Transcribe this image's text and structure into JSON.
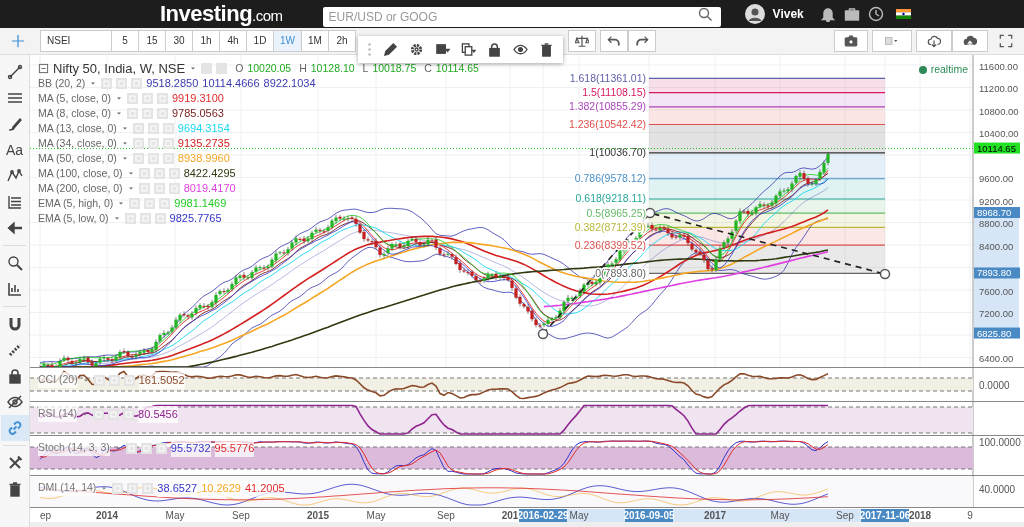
{
  "header": {
    "logo": "Investing",
    "logo_suffix": ".com",
    "search": {
      "placeholder": "EUR/USD or GOOG"
    },
    "user": "Vivek"
  },
  "toolbar": {
    "symbol": "NSEI",
    "intervals": [
      {
        "label": "5",
        "selected": false
      },
      {
        "label": "15",
        "selected": false
      },
      {
        "label": "30",
        "selected": false
      },
      {
        "label": "1h",
        "selected": false
      },
      {
        "label": "4h",
        "selected": false
      },
      {
        "label": "1D",
        "selected": false
      },
      {
        "label": "1W",
        "selected": true
      },
      {
        "label": "1M",
        "selected": false
      },
      {
        "label": "2h",
        "selected": false
      }
    ]
  },
  "sidebar": {
    "tools": [
      {
        "kind": "line",
        "selected": false
      },
      {
        "kind": "hlines",
        "selected": false
      },
      {
        "kind": "brush",
        "selected": false
      },
      {
        "kind": "text",
        "label": "Aa",
        "selected": false
      },
      {
        "kind": "pattern",
        "selected": false
      },
      {
        "kind": "fib",
        "selected": false
      },
      {
        "kind": "arrow",
        "selected": false
      },
      {
        "kind": "zoom",
        "selected": false
      },
      {
        "kind": "measure",
        "selected": false
      },
      {
        "kind": "magnet",
        "selected": false
      },
      {
        "kind": "ruler",
        "selected": false
      },
      {
        "kind": "lock",
        "selected": false
      },
      {
        "kind": "eye",
        "selected": false
      },
      {
        "kind": "link",
        "selected": true
      },
      {
        "kind": "tools",
        "selected": false
      },
      {
        "kind": "trash",
        "selected": false
      }
    ]
  },
  "chart": {
    "title": "Nifty 50, India, W, NSE",
    "ohlc": [
      {
        "label": "O",
        "value": "10020.05"
      },
      {
        "label": "H",
        "value": "10128.10"
      },
      {
        "label": "L",
        "value": "10018.75"
      },
      {
        "label": "C",
        "value": "10114.65"
      }
    ],
    "realtime": "realtime",
    "indicators": [
      {
        "name": "BB (20, 2)",
        "color": "#3a3ab0",
        "values": [
          "9518.2850",
          "10114.4666",
          "8922.1034"
        ]
      },
      {
        "name": "MA (5, close, 0)",
        "color": "#e02b2b",
        "values": [
          "9919.3100"
        ]
      },
      {
        "name": "MA (8, close, 0)",
        "color": "#7a2424",
        "values": [
          "9785.0563"
        ]
      },
      {
        "name": "MA (13, close, 0)",
        "color": "#1ad7f0",
        "values": [
          "9694.3154"
        ]
      },
      {
        "name": "MA (34, close, 0)",
        "color": "#d42020",
        "values": [
          "9135.2735"
        ]
      },
      {
        "name": "MA (50, close, 0)",
        "color": "#f5a623",
        "values": [
          "8938.9960"
        ]
      },
      {
        "name": "MA (100, close, 0)",
        "color": "#2f3a10",
        "values": [
          "8422.4295"
        ]
      },
      {
        "name": "MA (200, close, 0)",
        "color": "#e040e0",
        "values": [
          "8019.4170"
        ]
      },
      {
        "name": "EMA (5, high, 0)",
        "color": "#22cc22",
        "values": [
          "9981.1469"
        ]
      },
      {
        "name": "EMA (5, low, 0)",
        "color": "#3535c8",
        "values": [
          "9825.7765"
        ]
      }
    ],
    "fib_levels": [
      {
        "label": "1.618(11361.01)",
        "color": "#5b5fa8"
      },
      {
        "label": "1.5(11108.15)",
        "color": "#d81b60"
      },
      {
        "label": "1.382(10855.29)",
        "color": "#ab47bc"
      },
      {
        "label": "1.236(10542.42)",
        "color": "#e0504a"
      },
      {
        "label": "1(10036.70)",
        "color": "#333333"
      },
      {
        "label": "0.786(9578.12)",
        "color": "#4a90c8"
      },
      {
        "label": "0.618(9218.11)",
        "color": "#26a69a"
      },
      {
        "label": "0.5(8965.25)",
        "color": "#66bb6a"
      },
      {
        "label": "0.382(8712.39)",
        "color": "#b8b83a"
      },
      {
        "label": "0.236(8399.52)",
        "color": "#d9534f"
      },
      {
        "label": "0(7893.80)",
        "color": "#666666"
      }
    ],
    "price_axis": [
      "11600.00",
      "11200.00",
      "10800.00",
      "10400.00",
      "9600.00",
      "9200.00",
      "8800.00",
      "8400.00",
      "7600.00",
      "7200.00",
      "6400.00"
    ],
    "price_badges": [
      {
        "text": "10114.65",
        "color": "#22e022"
      },
      {
        "text": "8968.70",
        "color": "#4a8ac4"
      },
      {
        "text": "7893.80",
        "color": "#4a8ac4"
      },
      {
        "text": "6825.80",
        "color": "#4a8ac4"
      }
    ],
    "panes": [
      {
        "kind": "cci",
        "label": "CCI (20)",
        "values": [
          {
            "text": "161.5052",
            "color": "#8a4a2a"
          }
        ],
        "axis_label": "0.0000"
      },
      {
        "kind": "rsi",
        "label": "RSI (14)",
        "values": [
          {
            "text": "80.5456",
            "color": "#8e248e"
          }
        ]
      },
      {
        "kind": "stoch",
        "label": "Stoch (14, 3, 3)",
        "values": [
          {
            "text": "95.5732",
            "color": "#3535c8"
          },
          {
            "text": "95.5776",
            "color": "#e02b2b"
          }
        ],
        "axis_label": "100.0000"
      },
      {
        "kind": "dmi",
        "label": "DMI (14, 14)",
        "values": [
          {
            "text": "38.6527",
            "color": "#3535c8"
          },
          {
            "text": "10.2629",
            "color": "#f5a623"
          },
          {
            "text": "41.2005",
            "color": "#e02b2b"
          }
        ],
        "axis_label": "40.0000"
      }
    ],
    "time_axis": [
      {
        "text": "ep",
        "kind": "plain"
      },
      {
        "text": "2014",
        "kind": "year"
      },
      {
        "text": "May",
        "kind": "plain"
      },
      {
        "text": "Sep",
        "kind": "plain"
      },
      {
        "text": "2015",
        "kind": "year"
      },
      {
        "text": "May",
        "kind": "plain"
      },
      {
        "text": "Sep",
        "kind": "plain"
      },
      {
        "text": "201",
        "kind": "year"
      },
      {
        "text": "2016-02-29",
        "kind": "badge"
      },
      {
        "text": "May",
        "kind": "plain"
      },
      {
        "text": "2016-09-05",
        "kind": "badge"
      },
      {
        "text": "2017",
        "kind": "year"
      },
      {
        "text": "May",
        "kind": "plain"
      },
      {
        "text": "Sep",
        "kind": "plain"
      },
      {
        "text": "2017-11-06",
        "kind": "badge"
      },
      {
        "text": "2018",
        "kind": "year"
      },
      {
        "text": "9",
        "kind": "plain"
      }
    ]
  }
}
